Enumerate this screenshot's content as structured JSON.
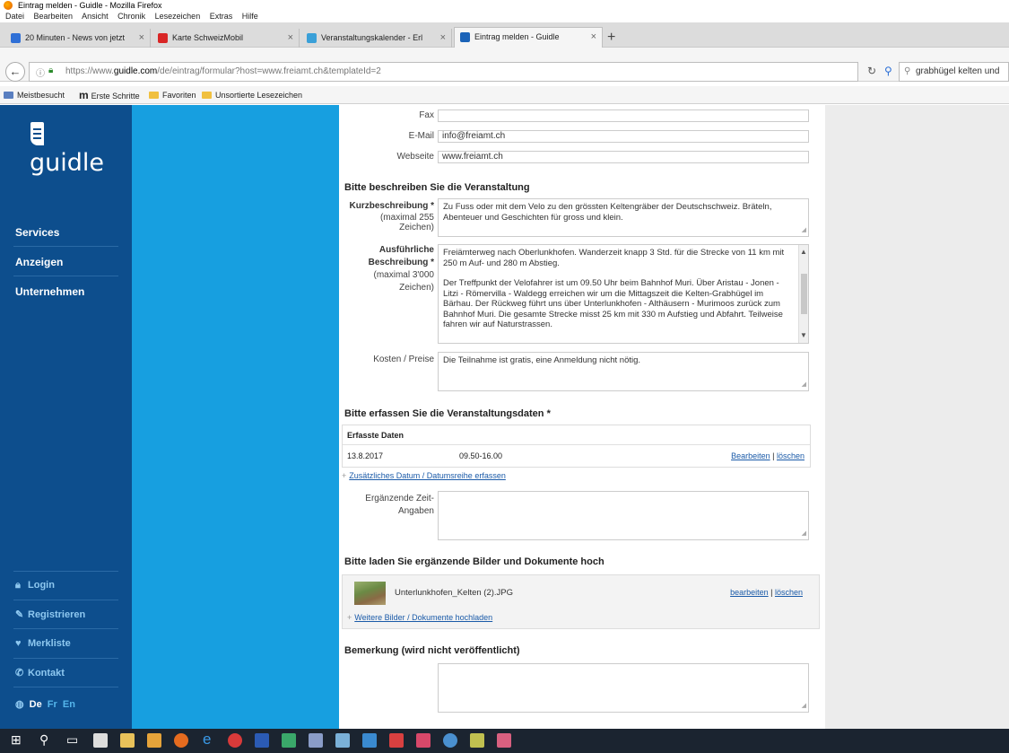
{
  "window": {
    "title": "Eintrag melden - Guidle - Mozilla Firefox"
  },
  "menu": [
    "Datei",
    "Bearbeiten",
    "Ansicht",
    "Chronik",
    "Lesezeichen",
    "Extras",
    "Hilfe"
  ],
  "tabs": [
    {
      "label": "20 Minuten - News von jetzt",
      "color": "#2f6fd6"
    },
    {
      "label": "Karte SchweizMobil",
      "color": "#d92626"
    },
    {
      "label": "Veranstaltungskalender - Erl",
      "color": "#3aa0d8"
    },
    {
      "label": "Eintrag melden - Guidle",
      "color": "#1b63b8"
    }
  ],
  "urlbar": {
    "url_prefix": "https://www.",
    "url_domain": "guidle.com",
    "url_rest": "/de/eintrag/formular?host=www.freiamt.ch&templateId=2"
  },
  "search": {
    "value": "grabhügel kelten und"
  },
  "bookmarks": [
    "Meistbesucht",
    "Erste Schritte",
    "Favoriten",
    "Unsortierte Lesezeichen"
  ],
  "sidebar": {
    "logo": "guidle",
    "nav": [
      "Services",
      "Anzeigen",
      "Unternehmen"
    ],
    "bottom": [
      {
        "label": "Login",
        "icon": "lock-icon"
      },
      {
        "label": "Registrieren",
        "icon": "pencil-icon"
      },
      {
        "label": "Merkliste",
        "icon": "heart-icon"
      },
      {
        "label": "Kontakt",
        "icon": "phone-icon"
      }
    ],
    "lang": {
      "active": "De",
      "others": [
        "Fr",
        "En"
      ]
    }
  },
  "form": {
    "fax_label": "Fax",
    "fax_value": "",
    "email_label": "E-Mail",
    "email_value": "info@freiamt.ch",
    "web_label": "Webseite",
    "web_value": "www.freiamt.ch",
    "section_describe": "Bitte beschreiben Sie die Veranstaltung",
    "short_label": "Kurzbeschreibung *",
    "short_hint": "(maximal 255 Zeichen)",
    "short_value": "Zu Fuss oder mit dem Velo zu den grössten Keltengräber der Deutschschweiz. Bräteln, Abenteuer und Geschichten für gross und klein.",
    "long_label_1": "Ausführliche",
    "long_label_2": "Beschreibung *",
    "long_hint_1": "(maximal 3'000",
    "long_hint_2": "Zeichen)",
    "long_value_p1": "Freiämterweg nach Oberlunkhofen. Wanderzeit knapp 3 Std. für die Strecke von 11 km mit 250 m Auf- und 280 m Abstieg.",
    "long_value_p2": "Der Treffpunkt der Velofahrer ist um 09.50 Uhr beim Bahnhof Muri. Über Aristau - Jonen - Litzi - Römervilla - Waldegg erreichen wir um die Mittagszeit die Kelten-Grabhügel im Bärhau. Der Rückweg führt uns über Unterlunkhofen - Althäusern - Murimoos zurück zum Bahnhof Muri. Die gesamte Strecke misst 25 km mit 330 m Aufstieg und Abfahrt. Teilweise fahren wir auf Naturstrassen.",
    "cost_label": "Kosten / Preise",
    "cost_value": "Die Teilnahme ist gratis, eine Anmeldung nicht nötig.",
    "section_dates": "Bitte erfassen Sie die Veranstaltungsdaten *",
    "dates_head": "Erfasste Daten",
    "date_value": "13.8.2017",
    "time_value": "09.50-16.00",
    "edit_link": "Bearbeiten",
    "delete_link": "löschen",
    "add_date_link": "Zusätzliches Datum / Datumsreihe erfassen",
    "extra_time_label_1": "Ergänzende Zeit-",
    "extra_time_label_2": "Angaben",
    "section_images": "Bitte laden Sie ergänzende Bilder und Dokumente hoch",
    "image_name": "Unterlunkhofen_Kelten (2).JPG",
    "image_edit": "bearbeiten",
    "image_delete": "löschen",
    "upload_link": "Weitere Bilder / Dokumente hochladen",
    "section_remark": "Bemerkung (wird nicht veröffentlicht)"
  }
}
